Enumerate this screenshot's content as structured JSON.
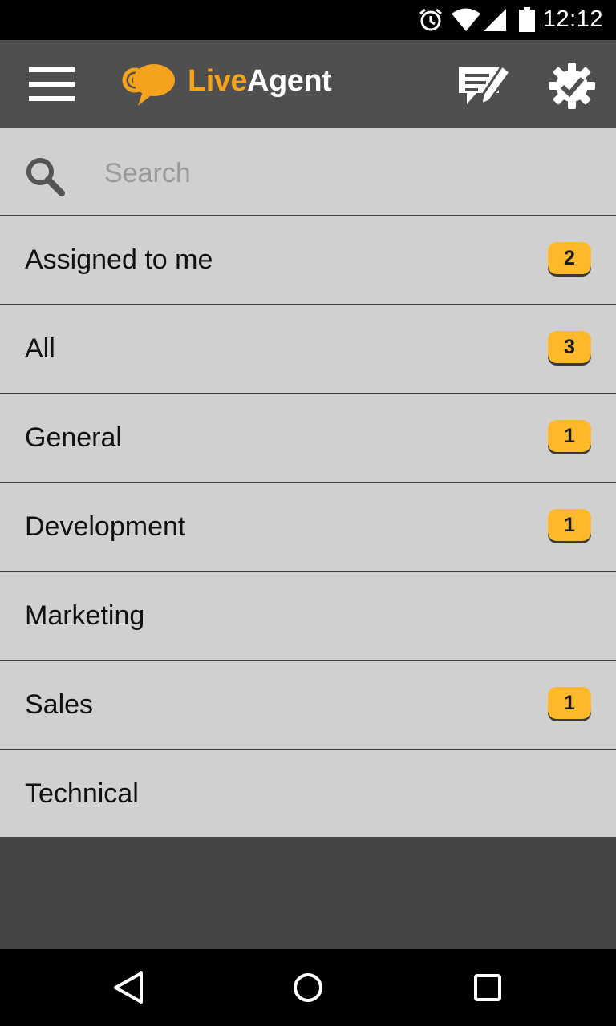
{
  "status_bar": {
    "time": "12:12",
    "icons": [
      "alarm-icon",
      "wifi-icon",
      "cell-signal-icon",
      "battery-icon"
    ]
  },
  "app_bar": {
    "logo_live": "Live",
    "logo_agent": "Agent",
    "icons": [
      "menu-icon",
      "compose-icon",
      "settings-check-icon"
    ],
    "colors": {
      "background": "#4f4f4f",
      "brand_orange": "#f5a21d"
    }
  },
  "search": {
    "placeholder": "Search",
    "value": ""
  },
  "departments": [
    {
      "label": "Assigned to me",
      "count": "2"
    },
    {
      "label": "All",
      "count": "3"
    },
    {
      "label": "General",
      "count": "1"
    },
    {
      "label": "Development",
      "count": "1"
    },
    {
      "label": "Marketing",
      "count": null
    },
    {
      "label": "Sales",
      "count": "1"
    },
    {
      "label": "Technical",
      "count": null
    }
  ],
  "badge_color": "#fdb92a",
  "nav_bar": {
    "icons": [
      "back-icon",
      "home-icon",
      "recents-icon"
    ]
  }
}
